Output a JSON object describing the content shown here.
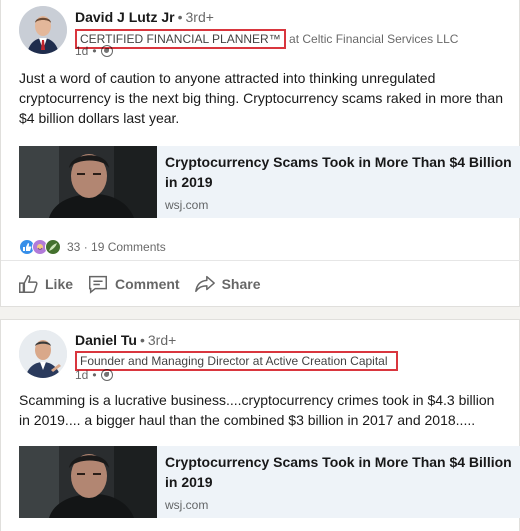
{
  "posts": [
    {
      "author": "David J Lutz Jr",
      "degree": "3rd+",
      "headline_highlighted": "CERTIFIED FINANCIAL PLANNER™",
      "headline_rest": " at Celtic Financial Services LLC",
      "time": "1d",
      "text": "Just a word of caution to anyone attracted into thinking unregulated cryptocurrency is the next big thing.  Cryptocurrency scams raked in more than $4 billion dollars last year.",
      "article": {
        "title": "Cryptocurrency Scams Took in More Than $4 Billion in 2019",
        "source": "wsj.com"
      },
      "reactions": {
        "icons": [
          "like-icon",
          "support-icon",
          "insightful-icon"
        ],
        "count": "33",
        "comments": "19 Comments"
      },
      "actions": {
        "like": "Like",
        "comment": "Comment",
        "share": "Share"
      }
    },
    {
      "author": "Daniel Tu",
      "degree": "3rd+",
      "headline_highlighted": "Founder and Managing Director at Active Creation Capital",
      "time": "1d",
      "text": "Scamming is a lucrative business....cryptocurrency crimes took in $4.3 billion in 2019.... a bigger haul than the combined $3 billion in 2017 and 2018.....",
      "article": {
        "title": "Cryptocurrency Scams Took in More Than $4 Billion in 2019",
        "source": "wsj.com"
      }
    }
  ],
  "colors": {
    "highlight_box": "#d9363e",
    "like_blue": "#378fe9",
    "support_purple": "#b17bd9",
    "insightful_green": "#44712e"
  }
}
